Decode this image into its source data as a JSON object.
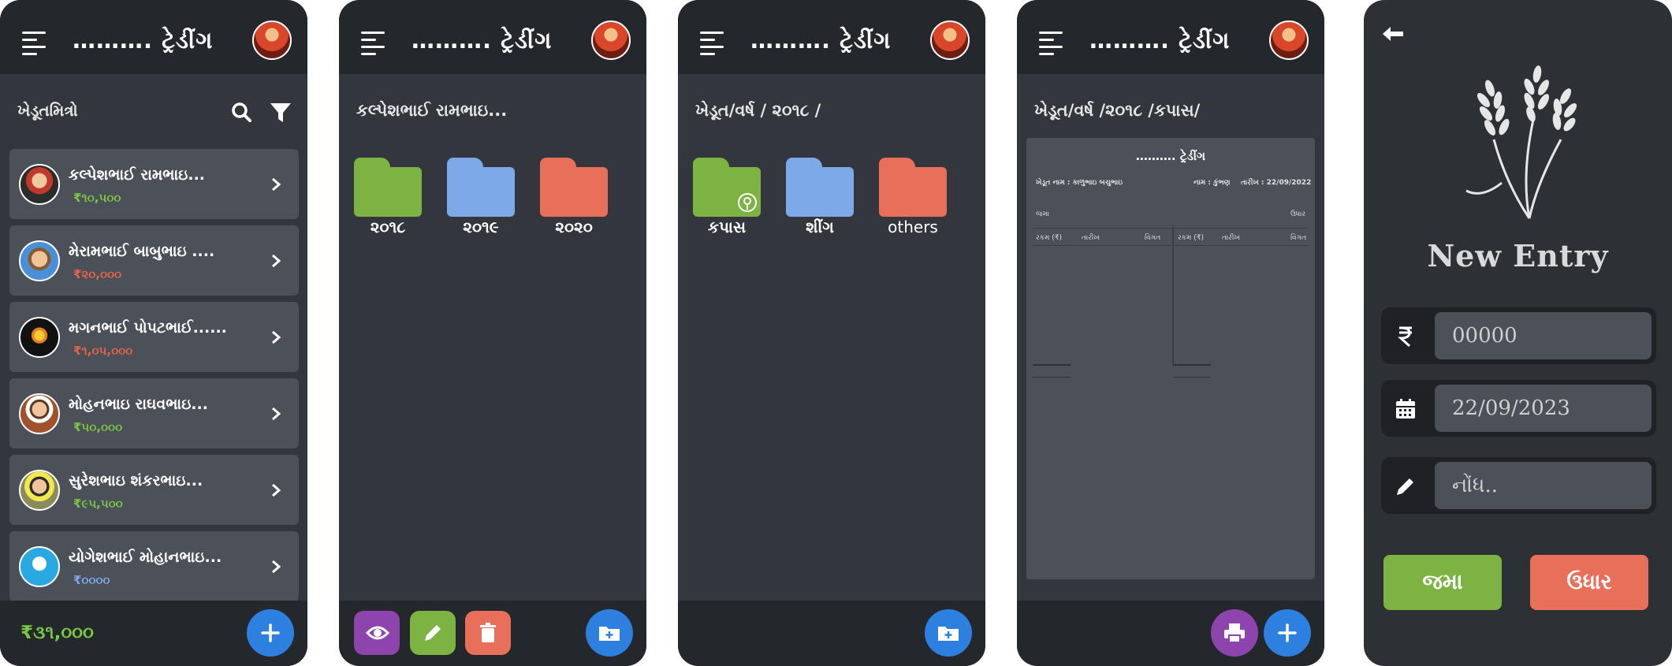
{
  "app": {
    "title": "………. ટ્રેડીંગ"
  },
  "panel1": {
    "heading": "ખેડૂતમિત્રો",
    "items": [
      {
        "name": "કલ્પેશભાઈ રામભાઇ...",
        "amount": "₹૧૦,૫૦૦",
        "amount_color": "#7ac943"
      },
      {
        "name": "મેરામભાઈ બાબુભાઇ ....",
        "amount": "₹૨૦,૦૦૦",
        "amount_color": "#e8644a"
      },
      {
        "name": "મગનભાઈ પોપટભાઈ......",
        "amount": "₹૧,૦૫,૦૦૦",
        "amount_color": "#e8644a"
      },
      {
        "name": "મોહનભાઇ રાઘવભાઇ...",
        "amount": "₹૫૦,૦૦૦",
        "amount_color": "#7ac943"
      },
      {
        "name": "સુરેશભાઇ શંકરભાઇ...",
        "amount": "₹૯૫,૫૦૦",
        "amount_color": "#7ac943"
      },
      {
        "name": "યોગેશભાઈ મોહાનભાઇ...",
        "amount": "₹૦૦૦૦",
        "amount_color": "#7ea9e8"
      }
    ],
    "total": "₹૩૧,૦૦૦"
  },
  "panel2": {
    "path": "કલ્પેશભાઈ રામભાઇ...",
    "folders": [
      {
        "label": "૨૦૧૮",
        "color": "#7cb342"
      },
      {
        "label": "૨૦૧૯",
        "color": "#7ea9e8"
      },
      {
        "label": "૨૦૨૦",
        "color": "#e8705a"
      }
    ]
  },
  "panel3": {
    "path": "ખેડૂત/વર્ષ / ૨૦૧૮ /",
    "folders": [
      {
        "label": "કપાસ",
        "color": "#7cb342"
      },
      {
        "label": "શીંગ",
        "color": "#7ea9e8"
      },
      {
        "label": "others",
        "color": "#e8705a"
      }
    ]
  },
  "panel4": {
    "path": "ખેડૂત/વર્ષ /૨૦૧૮ /કપાસ/",
    "doc": {
      "title": "………. ટ્રેડીંગ",
      "farmer": "ખેડૂત નામ : કાળુભાઇ બચુભાઇ",
      "name": "નામ : કુંભણ",
      "date": "તારીખ : 22/09/2022",
      "credit_label": "જમા",
      "debit_label": "ઉધાર",
      "col_amount": "રકમ (₹)",
      "col_date": "તારીખ",
      "col_detail": "વિગત"
    }
  },
  "panel5": {
    "title": "New Entry",
    "amount_placeholder": "00000",
    "date_value": "22/09/2023",
    "note_placeholder": "નોંધ..",
    "credit_button": "જમા",
    "debit_button": "ઉધાર"
  },
  "colors": {
    "fab_blue": "#2d7fe0",
    "view_purple": "#8e44ad",
    "edit_green": "#7cb342",
    "delete_red": "#e8705a",
    "credit_green": "#7cb342",
    "debit_red": "#e8705a"
  }
}
